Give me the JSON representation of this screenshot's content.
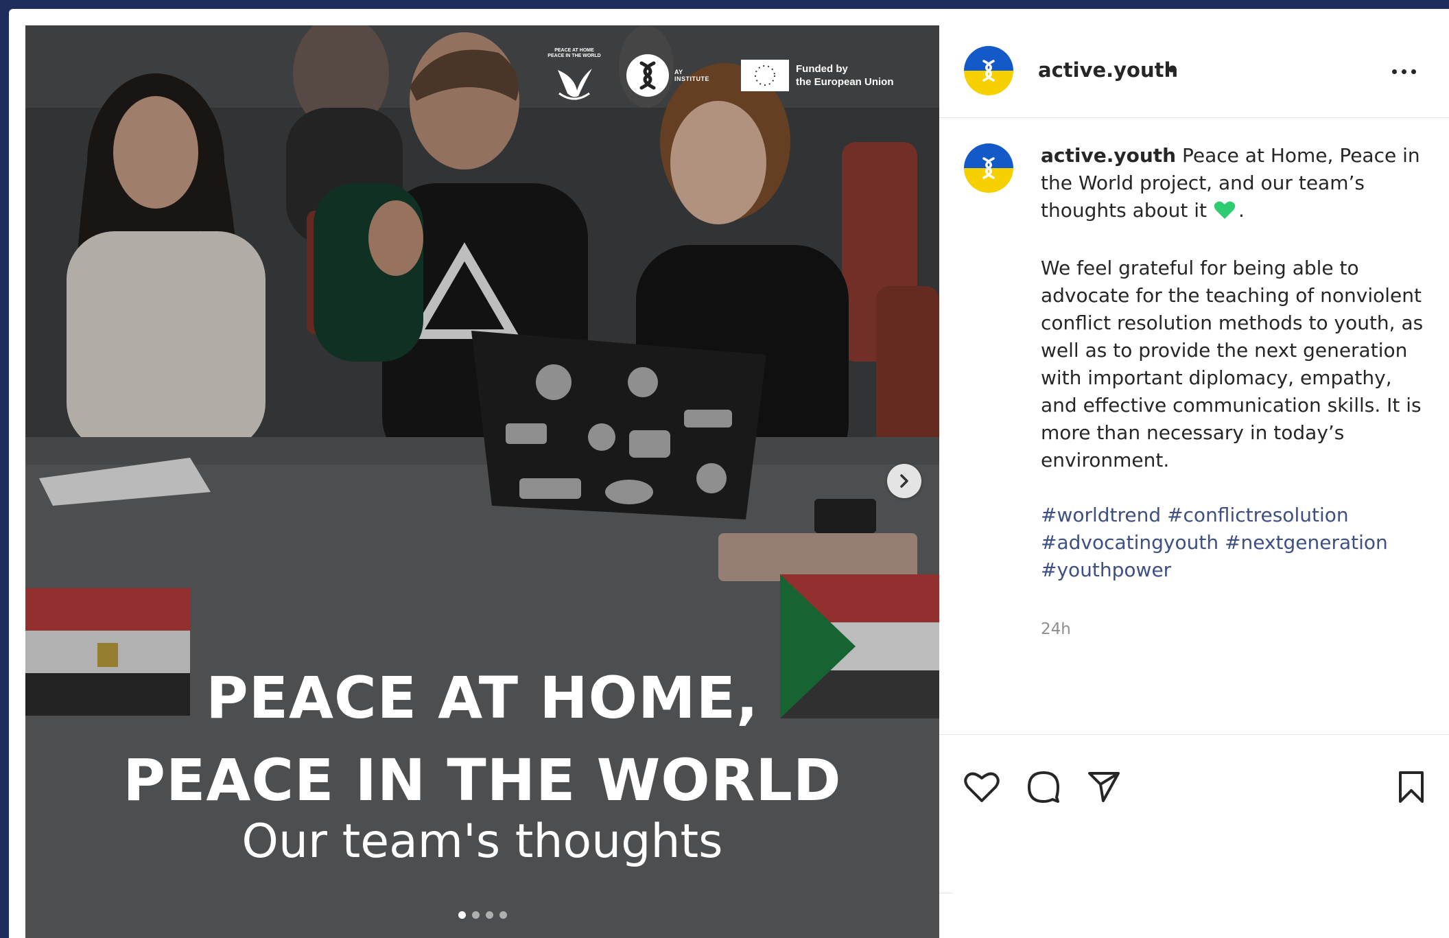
{
  "post": {
    "username": "active.youth",
    "header_dot": "•",
    "more_icon": "more-horizontal-icon",
    "media": {
      "partner_peace_text": "PEACE AT HOME\nPEACE IN THE WORLD",
      "partner_ay_text": "AY\nINSTITUTE",
      "partner_eu_text": "Funded by\nthe European Union",
      "headline": "PEACE AT HOME,\nPEACE IN THE WORLD",
      "subline": "Our team's thoughts",
      "carousel_count": 4,
      "carousel_active": 1
    },
    "caption": {
      "username": "active.youth",
      "intro": "Peace at Home, Peace in the World project, and our team’s thoughts about it",
      "intro_end": ".",
      "body": "We feel grateful for being able to advocate for the teaching of nonviolent conflict resolution methods to youth, as well as to provide the next generation with important diplomacy, empathy, and effective communication skills. It is more than necessary in today’s environment.",
      "hashtags": "#worldtrend #conflictresolution #advocatingyouth #nextgeneration #youthpower"
    },
    "timestamp": "24h",
    "actions": {
      "like_icon": "heart-outline-icon",
      "comment_icon": "comment-icon",
      "share_icon": "share-icon",
      "save_icon": "bookmark-icon"
    }
  },
  "colors": {
    "background": "#1e2d5c",
    "avatar_blue": "#1459c8",
    "avatar_yellow": "#f7d000",
    "hashtag": "#3d4f83",
    "heart_emoji": "#2ecc71"
  }
}
